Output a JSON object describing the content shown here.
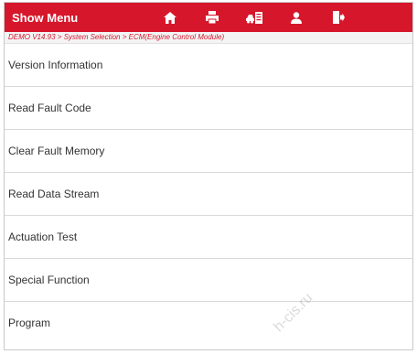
{
  "header": {
    "title": "Show Menu",
    "icons": [
      "home-icon",
      "print-icon",
      "car-vehicle-icon",
      "user-icon",
      "exit-icon"
    ]
  },
  "breadcrumb": "DEMO V14.93 > System Selection > ECM(Engine Control Module)",
  "menu": {
    "items": [
      {
        "label": "Version Information"
      },
      {
        "label": "Read Fault Code"
      },
      {
        "label": "Clear Fault Memory"
      },
      {
        "label": "Read Data Stream"
      },
      {
        "label": "Actuation Test"
      },
      {
        "label": "Special Function"
      },
      {
        "label": "Program"
      }
    ]
  },
  "watermark": "h-cis.ru",
  "colors": {
    "accent": "#d6162a",
    "divider": "#d9d9d9",
    "text": "#333333"
  }
}
